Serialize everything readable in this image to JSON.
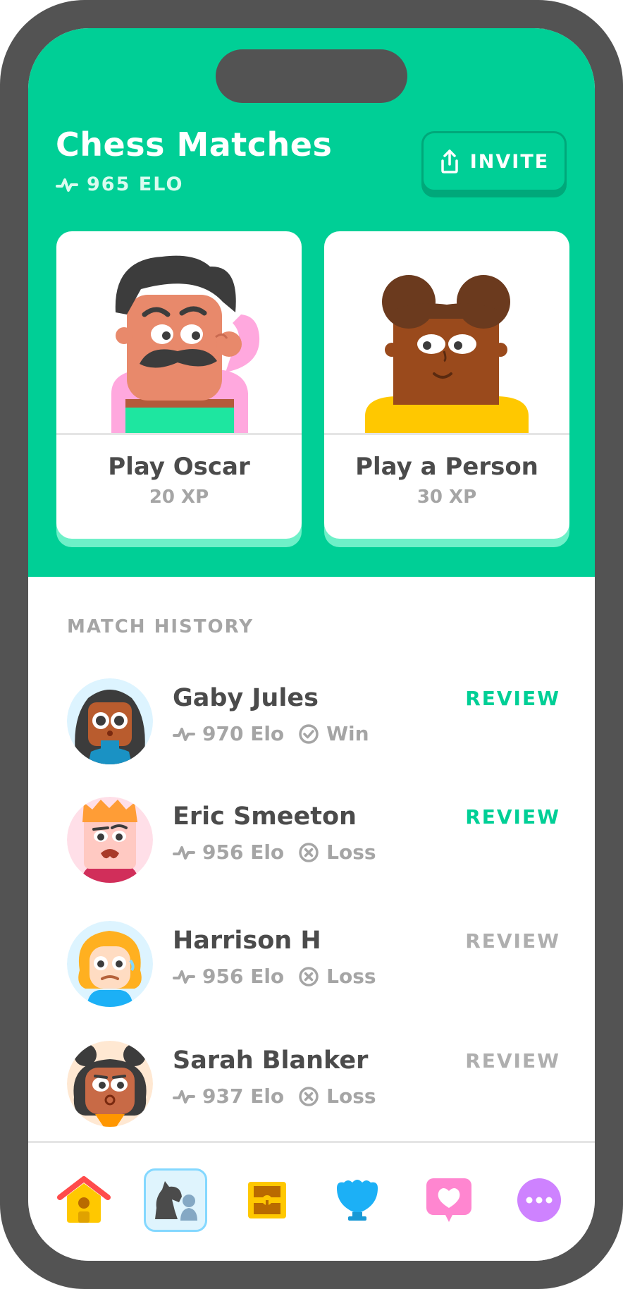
{
  "header": {
    "title": "Chess Matches",
    "elo": "965 ELO",
    "invite_label": "INVITE"
  },
  "cards": [
    {
      "label": "Play Oscar",
      "xp": "20 XP"
    },
    {
      "label": "Play a Person",
      "xp": "30 XP"
    }
  ],
  "history": {
    "title": "MATCH HISTORY",
    "matches": [
      {
        "name": "Gaby Jules",
        "elo": "970 Elo",
        "result": "Win",
        "review": "REVIEW",
        "review_active": true
      },
      {
        "name": "Eric Smeeton",
        "elo": "956 Elo",
        "result": "Loss",
        "review": "REVIEW",
        "review_active": true
      },
      {
        "name": "Harrison H",
        "elo": "956 Elo",
        "result": "Loss",
        "review": "REVIEW",
        "review_active": false
      },
      {
        "name": "Sarah Blanker",
        "elo": "937 Elo",
        "result": "Loss",
        "review": "REVIEW",
        "review_active": false
      }
    ]
  },
  "nav": {
    "items": [
      "home-icon",
      "chess-icon",
      "treasure-chest-icon",
      "shield-icon",
      "heart-chat-icon",
      "more-icon"
    ],
    "active_index": 1
  },
  "colors": {
    "brand_green": "#00CF96",
    "text_dark": "#4b4b4b",
    "text_muted": "#a5a5a5"
  }
}
